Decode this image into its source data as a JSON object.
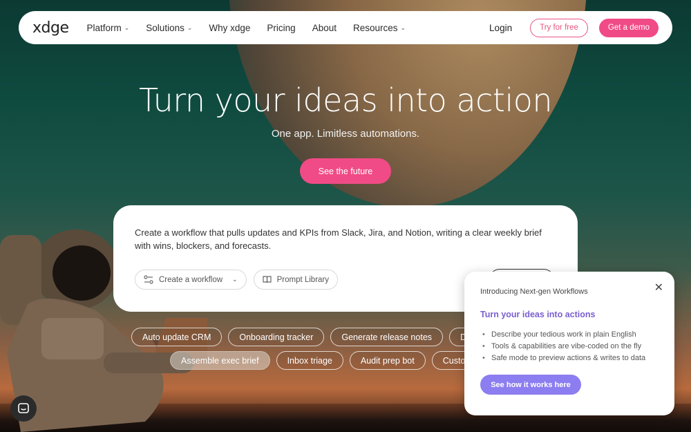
{
  "nav": {
    "logo": "xdge",
    "items": [
      {
        "label": "Platform",
        "dropdown": true
      },
      {
        "label": "Solutions",
        "dropdown": true
      },
      {
        "label": "Why xdge",
        "dropdown": false
      },
      {
        "label": "Pricing",
        "dropdown": false
      },
      {
        "label": "About",
        "dropdown": false
      },
      {
        "label": "Resources",
        "dropdown": true
      }
    ],
    "login": "Login",
    "try_free": "Try for free",
    "get_demo": "Get a demo"
  },
  "hero": {
    "title": "Turn your ideas into action",
    "subtitle": "One app. Limitless automations.",
    "cta": "See the future"
  },
  "prompt": {
    "text": "Create a workflow that pulls updates and KPIs from Slack, Jira, and Notion, writing a clear weekly brief with wins, blockers, and forecasts.",
    "mode_select": "Create a workflow",
    "library": "Prompt Library"
  },
  "chips": {
    "row1": [
      "Auto update CRM",
      "Onboarding tracker",
      "Generate release notes",
      "De"
    ],
    "row2": [
      "Assemble exec brief",
      "Inbox triage",
      "Audit prep bot",
      "Custo"
    ]
  },
  "popup": {
    "eyebrow": "Introducing Next-gen Workflows",
    "title": "Turn your ideas into actions",
    "bullets": [
      "Describe your tedious work in plain English",
      "Tools & capabilities are vibe-coded on the fly",
      "Safe mode to preview actions & writes to data"
    ],
    "button": "See how it works here"
  },
  "colors": {
    "accent_pink": "#f04b86",
    "accent_purple": "#8c7df0",
    "title_purple": "#7a5fcf"
  }
}
